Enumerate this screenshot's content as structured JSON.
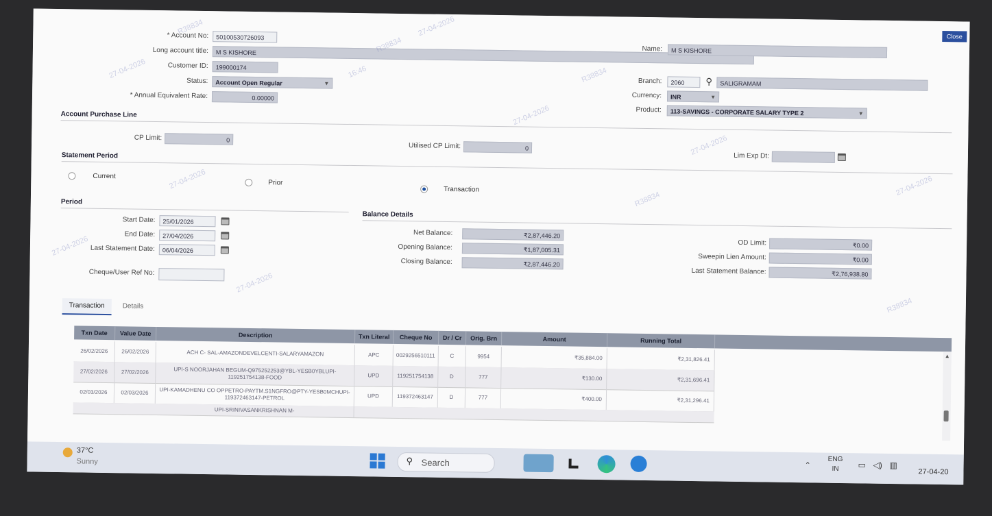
{
  "header": {
    "close_label": "Close"
  },
  "account": {
    "account_no_label": "* Account No:",
    "account_no": "50100530726093",
    "long_title_label": "Long account title:",
    "long_title": "M S KISHORE",
    "customer_id_label": "Customer ID:",
    "customer_id": "199000174",
    "status_label": "Status:",
    "status": "Account Open Regular",
    "annual_rate_label": "* Annual Equivalent Rate:",
    "annual_rate": "0.00000",
    "name_label": "Name:",
    "name": "M S KISHORE",
    "branch_label": "Branch:",
    "branch_code": "2060",
    "branch_name": "SALIGRAMAM",
    "currency_label": "Currency:",
    "currency": "INR",
    "product_label": "Product:",
    "product": "113-SAVINGS - CORPORATE SALARY TYPE 2"
  },
  "purchase_line": {
    "section": "Account Purchase Line",
    "cp_limit_label": "CP Limit:",
    "cp_limit": "0",
    "utilised_label": "Utilised CP Limit:",
    "utilised": "0",
    "lim_exp_label": "Lim Exp Dt:",
    "lim_exp": ""
  },
  "statement_period": {
    "section": "Statement Period",
    "options": [
      "Current",
      "Prior",
      "Transaction"
    ],
    "selected": "Transaction"
  },
  "period": {
    "section": "Period",
    "start_label": "Start Date:",
    "start": "25/01/2026",
    "end_label": "End Date:",
    "end": "27/04/2026",
    "last_stmt_label": "Last Statement Date:",
    "last_stmt": "06/04/2026",
    "cheque_label": "Cheque/User Ref No:",
    "cheque": ""
  },
  "balance": {
    "section": "Balance Details",
    "net_label": "Net Balance:",
    "net": "₹2,87,446.20",
    "opening_label": "Opening Balance:",
    "opening": "₹1,87,005.31",
    "closing_label": "Closing Balance:",
    "closing": "₹2,87,446.20",
    "od_label": "OD Limit:",
    "od": "₹0.00",
    "sweep_label": "Sweepin Lien Amount:",
    "sweep": "₹0.00",
    "last_stmt_bal_label": "Last Statement Balance:",
    "last_stmt_bal": "₹2,76,938.80"
  },
  "tabs": [
    "Transaction",
    "Details"
  ],
  "table": {
    "headers": [
      "Txn Date",
      "Value Date",
      "Description",
      "Txn Literal",
      "Cheque No",
      "Dr / Cr",
      "Orig. Brn",
      "Amount",
      "Running Total"
    ],
    "rows": [
      {
        "txn_date": "26/02/2026",
        "value_date": "26/02/2026",
        "desc": "ACH C- SAL-AMAZONDEVELCENTI-SALARYAMAZON",
        "literal": "APC",
        "cheque": "0029256510111",
        "drcr": "C",
        "brn": "9954",
        "amount": "₹35,884.00",
        "running": "₹2,31,826.41"
      },
      {
        "txn_date": "27/02/2026",
        "value_date": "27/02/2026",
        "desc": "UPI-S NOORJAHAN BEGUM-Q975252253@YBL-YESB0YBLUPI-119251754138-FOOD",
        "literal": "UPD",
        "cheque": "119251754138",
        "drcr": "D",
        "brn": "777",
        "amount": "₹130.00",
        "running": "₹2,31,696.41"
      },
      {
        "txn_date": "02/03/2026",
        "value_date": "02/03/2026",
        "desc": "UPI-KAMADHENU CO OPPETRO-PAYTM.S1NGFRO@PTY-YESB0MCHUPI-119372463147-PETROL",
        "literal": "UPD",
        "cheque": "119372463147",
        "drcr": "D",
        "brn": "777",
        "amount": "₹400.00",
        "running": "₹2,31,296.41"
      },
      {
        "txn_date": "",
        "value_date": "",
        "desc": "UPI-SRINIVASANKRISHNAN M-",
        "literal": "",
        "cheque": "",
        "drcr": "",
        "brn": "",
        "amount": "",
        "running": ""
      }
    ]
  },
  "taskbar": {
    "temp": "37°C",
    "weather": "Sunny",
    "search": "Search",
    "lang1": "ENG",
    "lang2": "IN",
    "date": "27-04-20"
  },
  "watermark": {
    "id": "R38834",
    "date": "27-04-2026",
    "time": "16:46"
  }
}
